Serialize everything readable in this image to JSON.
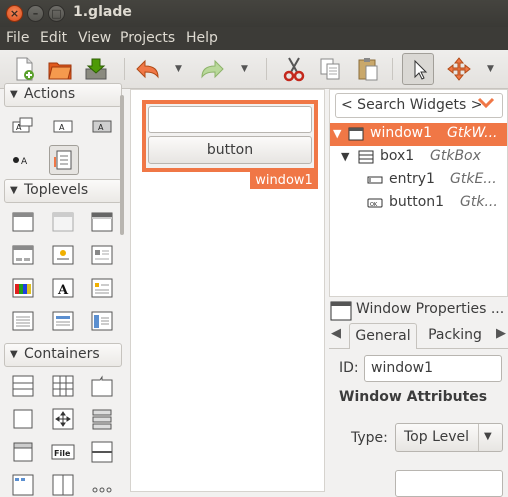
{
  "window": {
    "title": "1.glade"
  },
  "menubar": {
    "items": [
      "File",
      "Edit",
      "View",
      "Projects",
      "Help"
    ]
  },
  "toolbar": {
    "tools": [
      "new-file-icon",
      "open-folder-icon",
      "save-icon",
      "undo-icon",
      "redo-icon",
      "cut-icon",
      "copy-icon",
      "paste-icon",
      "pointer-icon",
      "drag-resize-icon"
    ]
  },
  "palette": {
    "groups": [
      {
        "label": "Actions",
        "icons": [
          "action-icon",
          "radio-action-icon",
          "toggle-action-icon",
          "recent-action-icon",
          "action-group-icon"
        ]
      },
      {
        "label": "Toplevels",
        "icons": [
          "window-icon",
          "offscreen-window-icon",
          "application-window-icon",
          "dialog-icon",
          "about-dialog-icon",
          "message-dialog-icon",
          "color-chooser-dialog-icon",
          "font-chooser-dialog-icon",
          "recent-chooser-dialog-icon",
          "file-chooser-dialog-icon",
          "app-chooser-dialog-icon",
          "assistant-icon"
        ]
      },
      {
        "label": "Containers",
        "icons": [
          "box-icon",
          "grid-icon",
          "notebook-icon",
          "frame-icon",
          "alignment-icon",
          "button-box-icon",
          "expander-icon",
          "file-chooser-widget-icon",
          "paned-icon",
          "menubar-icon",
          "toolbar-icon",
          "layout-icon"
        ]
      }
    ]
  },
  "canvas": {
    "button_label": "button",
    "selection_tag": "window1"
  },
  "inspector": {
    "search_placeholder": "< Search Widgets >",
    "tree": [
      {
        "name": "window1",
        "type": "GtkW...",
        "selected": true
      },
      {
        "name": "box1",
        "type": "GtkBox",
        "selected": false
      },
      {
        "name": "entry1",
        "type": "GtkE...",
        "selected": false
      },
      {
        "name": "button1",
        "type": "Gtk...",
        "selected": false
      }
    ]
  },
  "properties": {
    "title": "Window Properties ...",
    "tabs": [
      "General",
      "Packing"
    ],
    "id_label": "ID:",
    "id_value": "window1",
    "section_title": "Window Attributes",
    "type_label": "Type:",
    "type_value": "Top Level"
  },
  "colors": {
    "accent": "#f07746",
    "titlebar": "#3c3b37",
    "close_button": "#dc4c1c"
  }
}
